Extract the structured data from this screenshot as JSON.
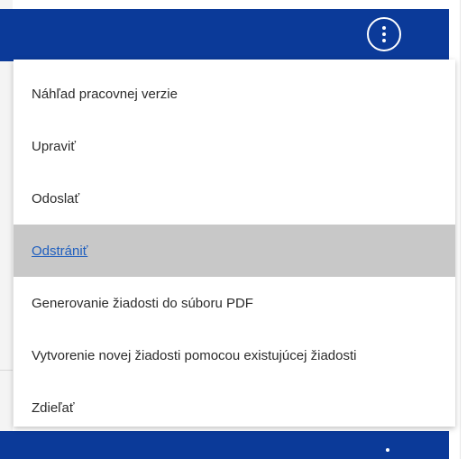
{
  "menu": {
    "items": [
      {
        "label": "Náhľad pracovnej verzie"
      },
      {
        "label": "Upraviť"
      },
      {
        "label": "Odoslať"
      },
      {
        "label": "Odstrániť",
        "state": "hover"
      },
      {
        "label": "Generovanie žiadosti do súboru PDF"
      },
      {
        "label": "Vytvorenie novej žiadosti pomocou existujúcej žiadosti"
      },
      {
        "label": "Zdieľať"
      }
    ]
  },
  "header": {
    "more_button_icon": "vertical-ellipsis-icon"
  },
  "colors": {
    "header_bg": "#0b3a99",
    "menu_hover_bg": "#c8c8c8",
    "link_color": "#1f5fbf",
    "text_color": "#2b2b2b"
  }
}
